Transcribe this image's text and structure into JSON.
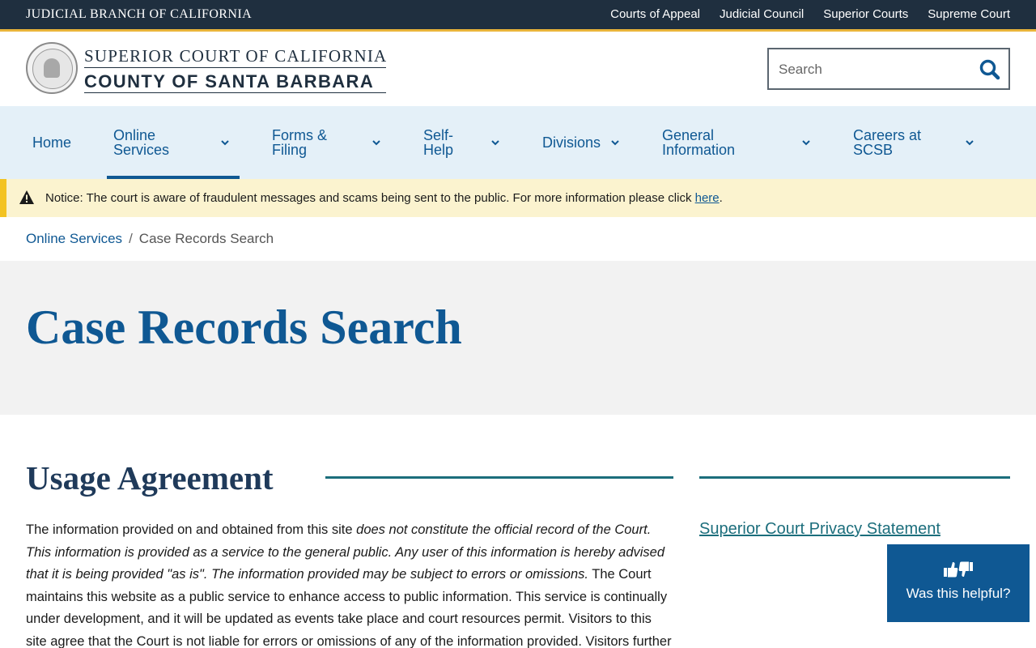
{
  "topbar": {
    "branch": "JUDICIAL BRANCH OF CALIFORNIA",
    "links": [
      "Courts of Appeal",
      "Judicial Council",
      "Superior Courts",
      "Supreme Court"
    ]
  },
  "header": {
    "court_line1": "SUPERIOR COURT OF CALIFORNIA",
    "court_line2": "COUNTY OF SANTA BARBARA",
    "search_placeholder": "Search"
  },
  "nav": {
    "items": [
      {
        "line1": "Home",
        "line2": ""
      },
      {
        "line1": "Online",
        "line2": "Services"
      },
      {
        "line1": "Forms &",
        "line2": "Filing"
      },
      {
        "line1": "Self-",
        "line2": "Help"
      },
      {
        "line1": "Divisions",
        "line2": ""
      },
      {
        "line1": "General",
        "line2": "Information"
      },
      {
        "line1": "Careers at",
        "line2": "SCSB"
      }
    ]
  },
  "notice": {
    "label": "Notice:",
    "text": " The court is aware of fraudulent messages and scams being sent to the public. For more information please click ",
    "link": "here",
    "end": "."
  },
  "breadcrumb": {
    "parent": "Online Services",
    "separator": "/",
    "current": "Case Records Search"
  },
  "page_title": "Case Records Search",
  "section": {
    "title": "Usage Agreement",
    "p1": "The information provided on and obtained from this site ",
    "p1_em": "does not constitute the official record of the Court. This information is provided as a service to the general public. Any user of this information is hereby advised that it is being provided \"as is\". The information provided may be subject to errors or omissions.",
    "p1_rest": " The Court maintains this website as a public service to enhance access to public information. This service is continually under development, and it will be updated as events take place and court resources permit. Visitors to this site agree that the Court is not liable for errors or omissions of any of the information provided. Visitors further consent"
  },
  "sidebar": {
    "link": "Superior Court Privacy Statement"
  },
  "feedback": {
    "label": "Was this helpful?"
  },
  "colors": {
    "topbar": "#1f2f3f",
    "accent": "#e9b43a",
    "nav_bg": "#e4f0f8",
    "brand_blue": "#0f5893",
    "teal": "#1c6e7c",
    "notice_bg": "#fbf3cf"
  }
}
